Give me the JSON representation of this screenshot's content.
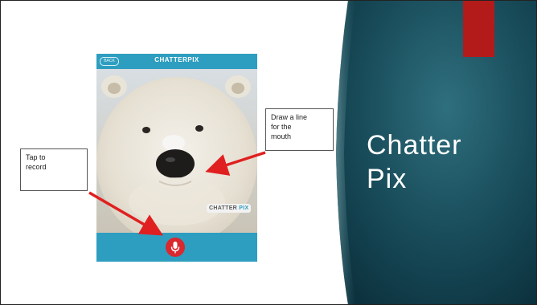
{
  "slide": {
    "title_line1": "Chatter",
    "title_line2": "Pix"
  },
  "app": {
    "title": "CHATTERPIX",
    "back_label": "BACK",
    "watermark_chatter": "CHATTER",
    "watermark_pix": "PIX"
  },
  "callouts": {
    "record": [
      "Tap to",
      "record"
    ],
    "mouth": [
      "Draw a line",
      "for the",
      "mouth"
    ]
  },
  "colors": {
    "accent_red": "#b31b1b",
    "app_blue": "#2e9ec0",
    "teal_dark": "#103a48",
    "arrow_red": "#e02020"
  },
  "icons": {
    "record_button": "microphone-icon",
    "back": "back-button"
  }
}
